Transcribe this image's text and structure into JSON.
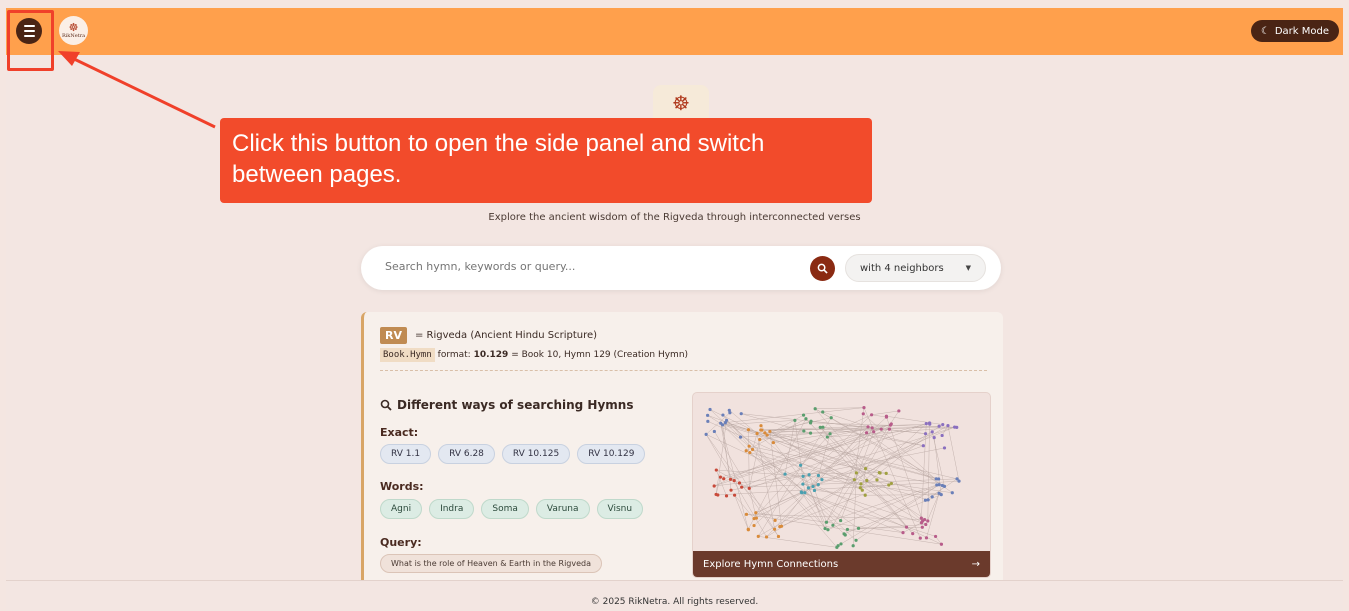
{
  "header": {
    "logo_text": "RikNetra",
    "dark_mode_label": "Dark Mode"
  },
  "hero": {
    "tagline": "Explore the ancient wisdom of the Rigveda through interconnected verses"
  },
  "search": {
    "placeholder": "Search hymn, keywords or query...",
    "neighbors_label": "with 4 neighbors"
  },
  "info": {
    "rv_badge": "RV",
    "rv_desc": "= Rigveda (Ancient Hindu Scripture)",
    "format_code": "Book.Hymn",
    "format_text": "format:",
    "format_example": "10.129",
    "format_desc": "= Book 10, Hymn 129 (Creation Hymn)"
  },
  "ways": {
    "title": "Different ways of searching Hymns",
    "exact_label": "Exact:",
    "exact": [
      "RV 1.1",
      "RV 6.28",
      "RV 10.125",
      "RV 10.129"
    ],
    "words_label": "Words:",
    "words": [
      "Agni",
      "Indra",
      "Soma",
      "Varuna",
      "Visnu"
    ],
    "query_label": "Query:",
    "query": "What is the role of Heaven & Earth in the Rigveda"
  },
  "graph": {
    "explore_label": "Explore Hymn Connections"
  },
  "footer": {
    "text": "© 2025 RikNetra. All rights reserved."
  },
  "callout": {
    "text": "Click this button to open the side panel and switch between pages."
  },
  "colors": {
    "topbar": "#ffa04c",
    "accent": "#4a2414",
    "callout": "#f24b2b"
  }
}
